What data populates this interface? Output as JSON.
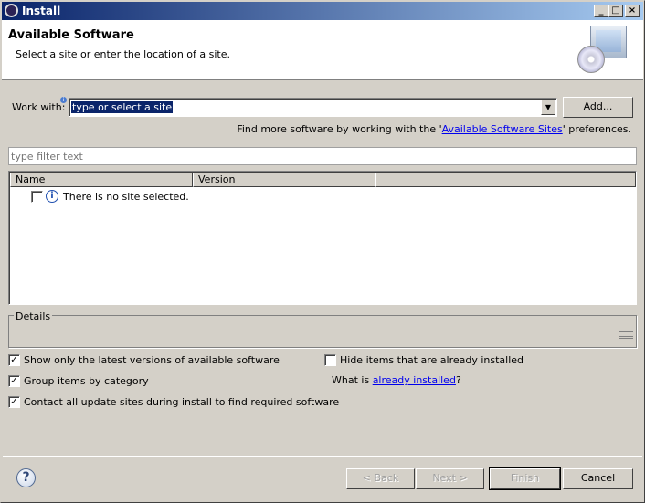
{
  "window": {
    "title": "Install"
  },
  "header": {
    "title": "Available Software",
    "subtitle": "Select a site or enter the location of a site."
  },
  "work_with": {
    "label": "Work with:",
    "value": "type or select a site",
    "add_label": "Add..."
  },
  "sites_hint": {
    "prefix": "Find more software by working with the '",
    "link": "Available Software Sites",
    "suffix": "' preferences."
  },
  "filter": {
    "placeholder": "type filter text"
  },
  "table": {
    "columns": [
      "Name",
      "Version"
    ],
    "rows": [
      {
        "name": "There is no site selected.",
        "checked": false
      }
    ]
  },
  "details": {
    "label": "Details"
  },
  "options": {
    "show_latest": {
      "label": "Show only the latest versions of available software",
      "checked": true
    },
    "group_category": {
      "label": "Group items by category",
      "checked": true
    },
    "contact_sites": {
      "label": "Contact all update sites during install to find required software",
      "checked": true
    },
    "hide_installed": {
      "label": "Hide items that are already installed",
      "checked": false
    },
    "what_is_prefix": "What is ",
    "what_is_link": "already installed",
    "what_is_suffix": "?"
  },
  "buttons": {
    "back": "< Back",
    "next": "Next >",
    "finish": "Finish",
    "cancel": "Cancel"
  }
}
